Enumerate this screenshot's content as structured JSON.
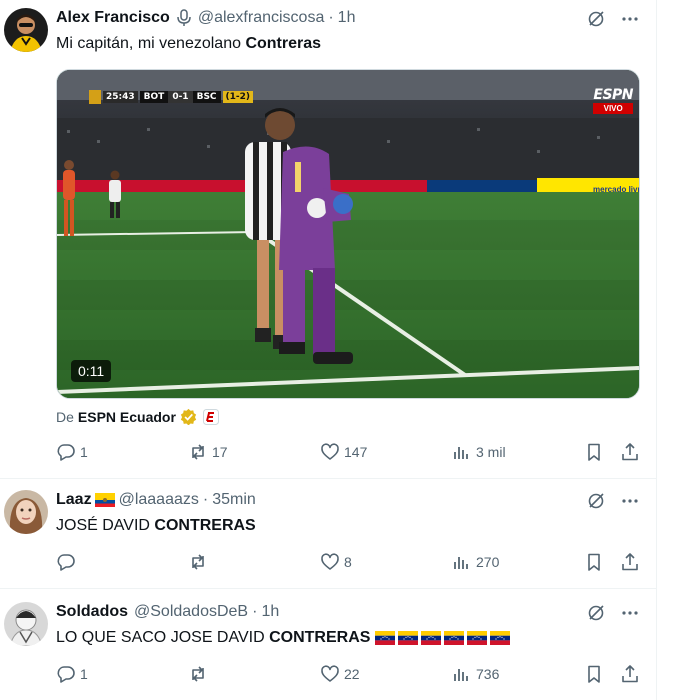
{
  "tweets": [
    {
      "name": "Alex Francisco",
      "handle": "@alexfranciscosa",
      "time": "1h",
      "text_plain": "Mi capitán, mi venezolano ",
      "text_bold": "Contreras",
      "media": {
        "scoreboard": {
          "clock": "25:43",
          "home": "BOT",
          "score": "0-1",
          "away": "BSC",
          "agg": "(1-2)"
        },
        "broadcaster": "ESPN",
        "live": "VIVO",
        "ad_board": "mercado livre",
        "duration": "0:11"
      },
      "source_prefix": "De",
      "source_name": "ESPN Ecuador",
      "stats": {
        "replies": "1",
        "reposts": "17",
        "likes": "147",
        "views": "3 mil"
      }
    },
    {
      "name": "Laaz",
      "handle": "@laaaaazs",
      "time": "35min",
      "text_plain": "JOSÉ DAVID ",
      "text_bold": "CONTRERAS",
      "stats": {
        "replies": "",
        "reposts": "",
        "likes": "8",
        "views": "270"
      }
    },
    {
      "name": "Soldados",
      "handle": "@SoldadosDeB",
      "time": "1h",
      "text_plain": "LO QUE SACO JOSE DAVID ",
      "text_bold": "CONTRERAS",
      "stats": {
        "replies": "1",
        "reposts": "",
        "likes": "22",
        "views": "736"
      }
    }
  ],
  "icons": {
    "grok": "grok-icon",
    "more": "more-icon",
    "reply": "reply-icon",
    "repost": "repost-icon",
    "like": "like-icon",
    "views": "views-icon",
    "bookmark": "bookmark-icon",
    "share": "share-icon"
  },
  "colors": {
    "text": "#0f1419",
    "muted": "#536471",
    "border": "#eff3f4",
    "gold": "#e2b719",
    "espn_red": "#d00000"
  }
}
